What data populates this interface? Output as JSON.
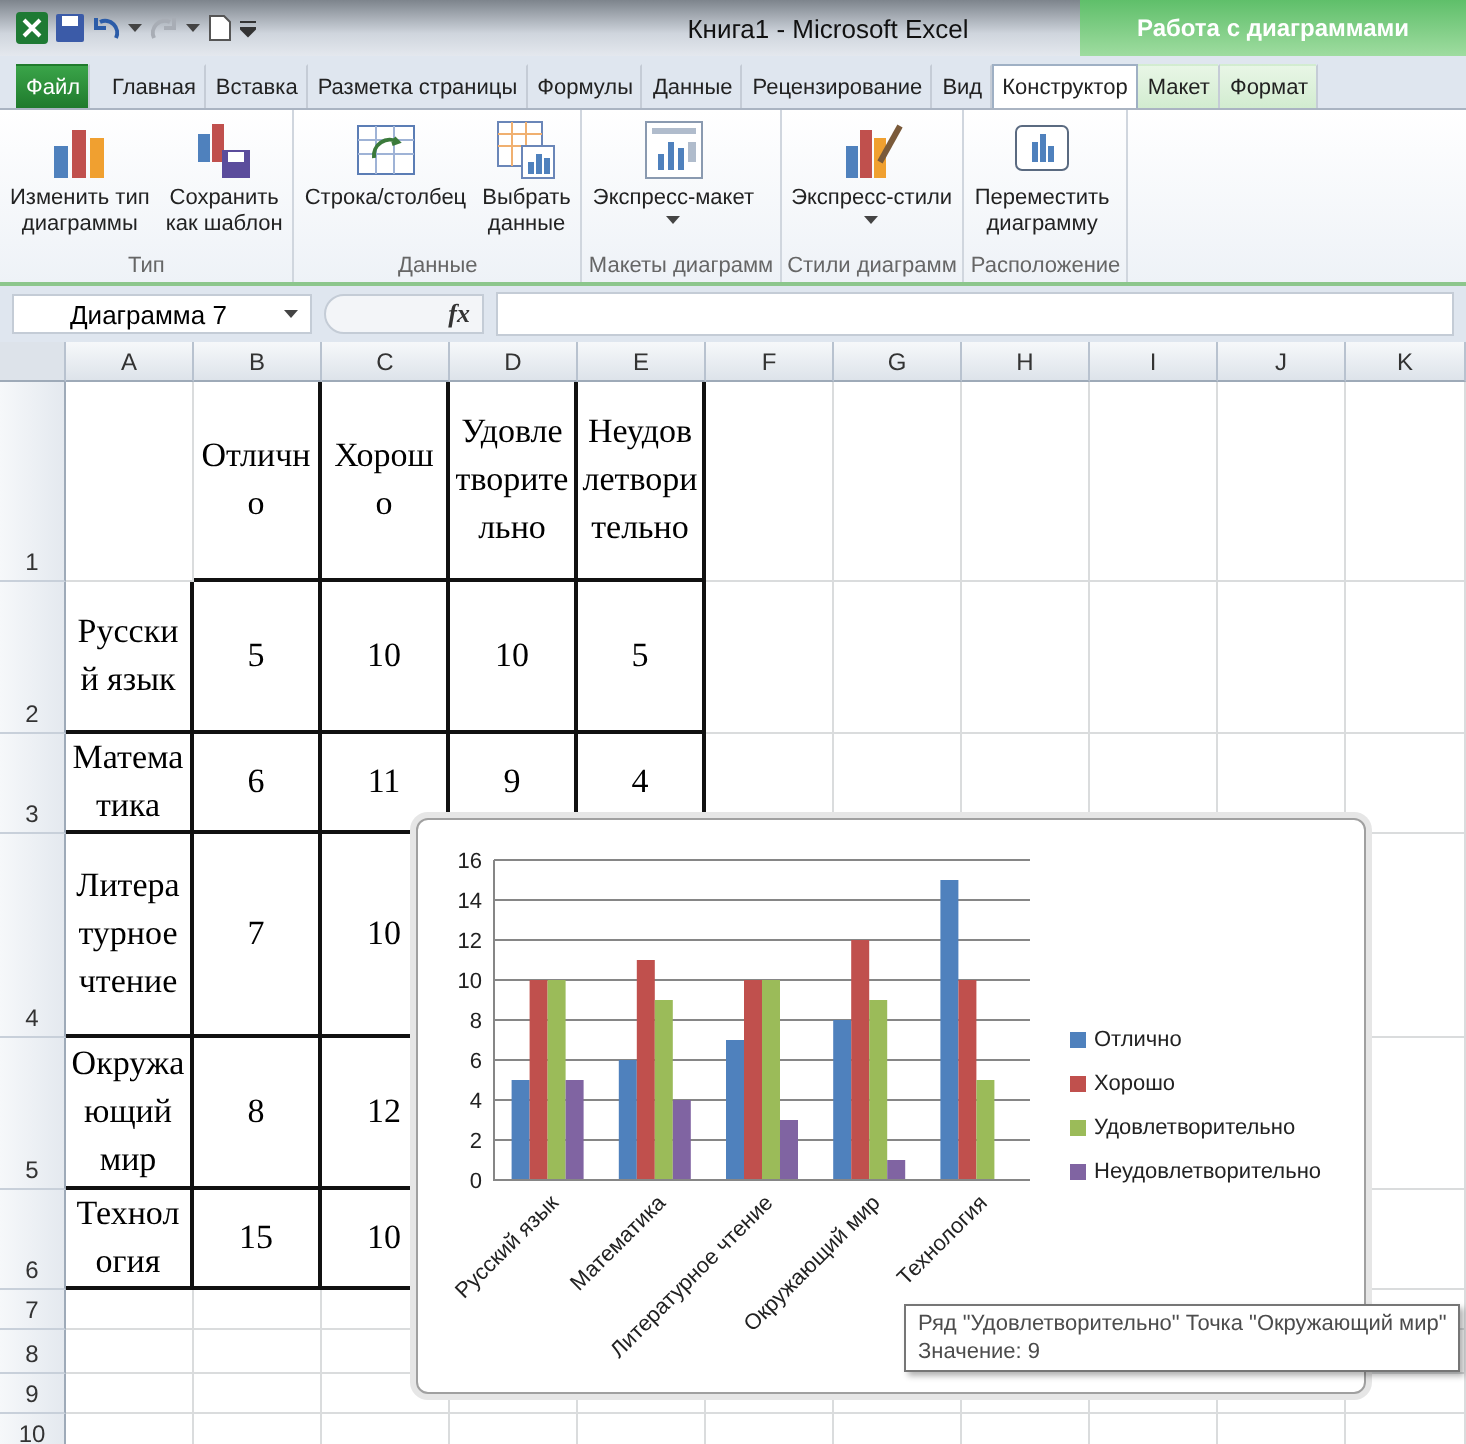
{
  "window": {
    "title": "Книга1  -  Microsoft Excel",
    "context_header": "Работа с диаграммами"
  },
  "tabs": [
    {
      "label": "Файл",
      "kind": "file",
      "selected": false
    },
    {
      "label": "Главная",
      "kind": "normal",
      "selected": false
    },
    {
      "label": "Вставка",
      "kind": "normal",
      "selected": false
    },
    {
      "label": "Разметка страницы",
      "kind": "normal",
      "selected": false
    },
    {
      "label": "Формулы",
      "kind": "normal",
      "selected": false
    },
    {
      "label": "Данные",
      "kind": "normal",
      "selected": false
    },
    {
      "label": "Рецензирование",
      "kind": "normal",
      "selected": false
    },
    {
      "label": "Вид",
      "kind": "normal",
      "selected": false
    },
    {
      "label": "Конструктор",
      "kind": "context",
      "selected": true
    },
    {
      "label": "Макет",
      "kind": "context",
      "selected": false
    },
    {
      "label": "Формат",
      "kind": "context",
      "selected": false
    }
  ],
  "ribbon_groups": [
    {
      "label": "Тип",
      "buttons": [
        {
          "label": "Изменить тип\nдиаграммы",
          "kind": "chart-type",
          "dropdown": false
        },
        {
          "label": "Сохранить\nкак шаблон",
          "kind": "save-template",
          "dropdown": false
        }
      ]
    },
    {
      "label": "Данные",
      "buttons": [
        {
          "label": "Строка/столбец",
          "kind": "switch",
          "dropdown": false
        },
        {
          "label": "Выбрать\nданные",
          "kind": "select-data",
          "dropdown": false
        }
      ]
    },
    {
      "label": "Макеты диаграмм",
      "buttons": [
        {
          "label": "Экспресс-макет",
          "kind": "layout",
          "dropdown": true
        }
      ]
    },
    {
      "label": "Стили диаграмм",
      "buttons": [
        {
          "label": "Экспресс-стили",
          "kind": "styles",
          "dropdown": true
        }
      ]
    },
    {
      "label": "Расположение",
      "buttons": [
        {
          "label": "Переместить\nдиаграмму",
          "kind": "move",
          "dropdown": false
        }
      ]
    }
  ],
  "formula_bar": {
    "name_box": "Диаграмма 7",
    "fx": "fx"
  },
  "columns": [
    "A",
    "B",
    "C",
    "D",
    "E",
    "F",
    "G",
    "H",
    "I",
    "J",
    "K"
  ],
  "rows": [
    {
      "number": "1",
      "cells": {
        "B": "Отлично",
        "C": "Хорошо",
        "D": "Удовлетворительно",
        "E": "Неудовлетворительно"
      }
    },
    {
      "number": "2",
      "cells": {
        "A": "Русский язык",
        "B": "5",
        "C": "10",
        "D": "10",
        "E": "5"
      }
    },
    {
      "number": "3",
      "cells": {
        "A": "Математика",
        "B": "6",
        "C": "11",
        "D": "9",
        "E": "4"
      }
    },
    {
      "number": "4",
      "cells": {
        "A": "Литературное чтение",
        "B": "7",
        "C": "10"
      }
    },
    {
      "number": "5",
      "cells": {
        "A": "Окружающий мир",
        "B": "8",
        "C": "12"
      }
    },
    {
      "number": "6",
      "cells": {
        "A": "Технология",
        "B": "15",
        "C": "10"
      }
    },
    {
      "number": "7"
    },
    {
      "number": "8"
    },
    {
      "number": "9"
    },
    {
      "number": "10"
    }
  ],
  "chart": {
    "chart_data": {
      "type": "bar",
      "categories": [
        "Русский язык",
        "Математика",
        "Литературное чтение",
        "Окружающий мир",
        "Технология"
      ],
      "series": [
        {
          "name": "Отлично",
          "color": "#4f81bd",
          "values": [
            5,
            6,
            7,
            8,
            15
          ]
        },
        {
          "name": "Хорошо",
          "color": "#c0504d",
          "values": [
            10,
            11,
            10,
            12,
            10
          ]
        },
        {
          "name": "Удовлетворительно",
          "color": "#9bbb59",
          "values": [
            10,
            9,
            10,
            9,
            5
          ]
        },
        {
          "name": "Неудовлетворительно",
          "color": "#8064a2",
          "values": [
            5,
            4,
            3,
            1,
            0
          ]
        }
      ],
      "ylim": [
        0,
        16
      ],
      "yticks": [
        {
          "value": 0,
          "label": "0"
        },
        {
          "value": 2,
          "label": "2"
        },
        {
          "value": 4,
          "label": "4"
        },
        {
          "value": 6,
          "label": "6"
        },
        {
          "value": 8,
          "label": "8"
        },
        {
          "value": 10,
          "label": "10"
        },
        {
          "value": 12,
          "label": "12"
        },
        {
          "value": 14,
          "label": "14"
        },
        {
          "value": 16,
          "label": "16"
        }
      ],
      "grid": true
    }
  },
  "tooltip": {
    "lines": [
      "Ряд \"Удовлетворительно\" Точка \"Окружающий мир\"",
      "Значение: 9"
    ]
  }
}
